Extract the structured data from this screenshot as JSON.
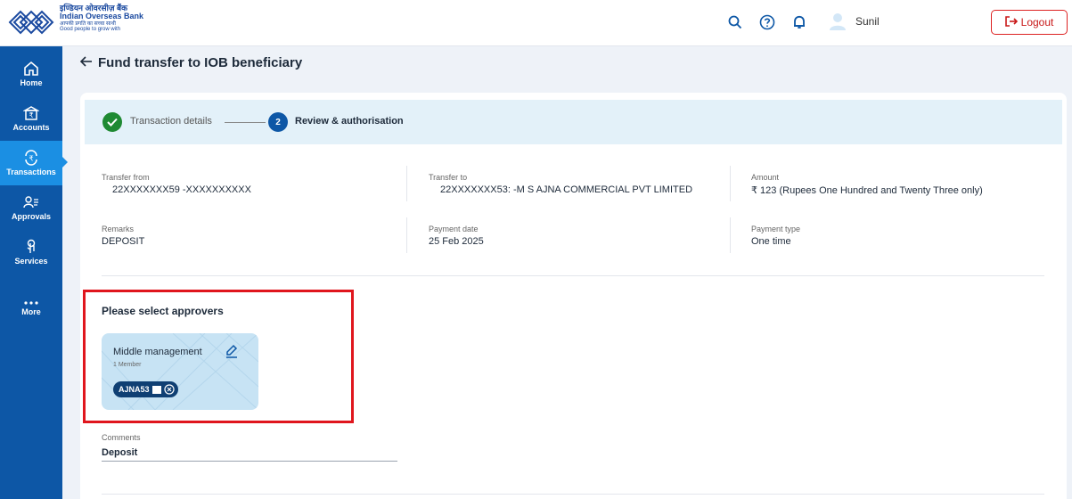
{
  "brand": {
    "hindi_name": "इण्डियन ओवरसीज़ बैंक",
    "english_name": "Indian Overseas Bank",
    "tagline_hindi": "आपकी प्रगति का सच्चा साथी",
    "tagline_english": "Good people to grow with",
    "color": "#1b4aa0"
  },
  "header": {
    "icons": [
      "search-icon",
      "help-icon",
      "bell-icon",
      "user-avatar-icon"
    ],
    "user_name": "Sunil",
    "logout_label": "Logout"
  },
  "sidebar": {
    "items": [
      {
        "label": "Home",
        "icon": "home-icon",
        "active": false
      },
      {
        "label": "Accounts",
        "icon": "bank-icon",
        "active": false
      },
      {
        "label": "Transactions",
        "icon": "rupee-exchange-icon",
        "active": true
      },
      {
        "label": "Approvals",
        "icon": "users-check-icon",
        "active": false
      },
      {
        "label": "Services",
        "icon": "hand-tap-icon",
        "active": false
      },
      {
        "label": "More",
        "icon": "more-dots-icon",
        "active": false
      }
    ]
  },
  "page": {
    "title": "Fund transfer to IOB beneficiary"
  },
  "stepper": {
    "step1_label": "Transaction details",
    "step2_number": "2",
    "step2_label": "Review & authorisation"
  },
  "details": {
    "transfer_from_label": "Transfer from",
    "transfer_from_value": "22XXXXXXX59   -XXXXXXXXXX",
    "transfer_to_label": "Transfer to",
    "transfer_to_value": "22XXXXXXX53:   -M S AJNA COMMERCIAL PVT LIMITED",
    "amount_label": "Amount",
    "amount_value": "₹ 123 (Rupees One Hundred and Twenty Three  only)",
    "remarks_label": "Remarks",
    "remarks_value": "DEPOSIT",
    "payment_date_label": "Payment date",
    "payment_date_value": "25 Feb 2025",
    "payment_type_label": "Payment type",
    "payment_type_value": "One time"
  },
  "approvers": {
    "title": "Please select approvers",
    "group_name": "Middle management",
    "member_count": "1 Member",
    "chip_label": "AJNA53"
  },
  "comments": {
    "label": "Comments",
    "value": "Deposit"
  },
  "colors": {
    "sidebar_bg": "#0d57a6",
    "sidebar_active": "#1b8fe3",
    "step_done": "#1f8a33",
    "step_current": "#0d57a6",
    "logout": "#c81818",
    "highlight": "#e0161d"
  }
}
